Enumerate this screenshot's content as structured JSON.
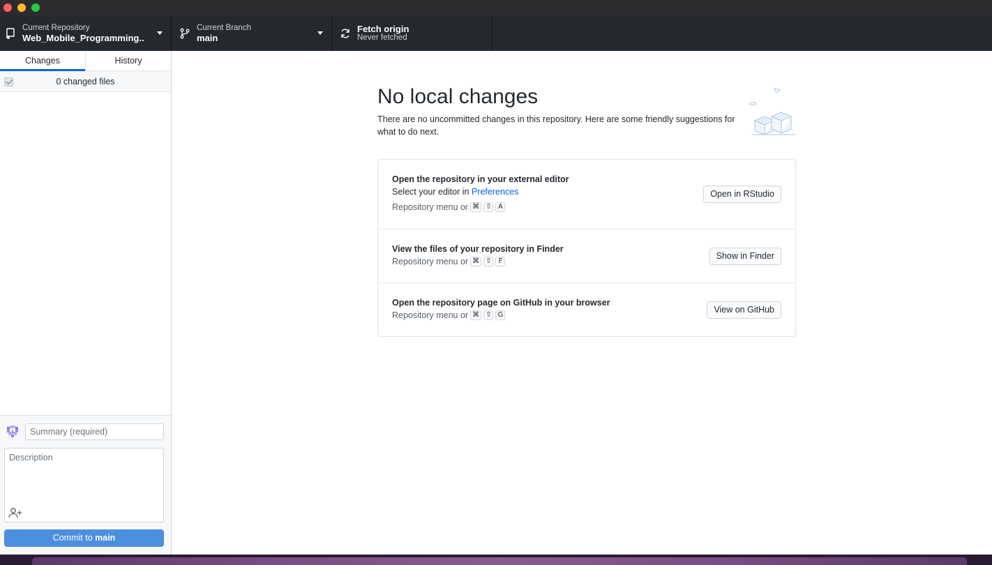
{
  "toolbar": {
    "repo": {
      "label": "Current Repository",
      "value": "Web_Mobile_Programming..."
    },
    "branch": {
      "label": "Current Branch",
      "value": "main"
    },
    "fetch": {
      "label": "Fetch origin",
      "status": "Never fetched"
    }
  },
  "sidebar": {
    "tabs": [
      {
        "label": "Changes"
      },
      {
        "label": "History"
      }
    ],
    "changed_files_label": "0 changed files",
    "commit": {
      "summary_placeholder": "Summary (required)",
      "description_placeholder": "Description",
      "button_prefix": "Commit to ",
      "button_branch": "main"
    }
  },
  "main": {
    "title": "No local changes",
    "subtitle": "There are no uncommitted changes in this repository. Here are some friendly suggestions for what to do next.",
    "suggestions": [
      {
        "title": "Open the repository in your external editor",
        "line_prefix": "Select your editor in ",
        "line_link": "Preferences",
        "menu_text": "Repository menu or",
        "keys": [
          "⌘",
          "⇧",
          "A"
        ],
        "button": "Open in RStudio"
      },
      {
        "title": "View the files of your repository in Finder",
        "menu_text": "Repository menu or",
        "keys": [
          "⌘",
          "⇧",
          "F"
        ],
        "button": "Show in Finder"
      },
      {
        "title": "Open the repository page on GitHub in your browser",
        "menu_text": "Repository menu or",
        "keys": [
          "⌘",
          "⇧",
          "G"
        ],
        "button": "View on GitHub"
      }
    ]
  },
  "colors": {
    "accent": "#0366d6",
    "commit_button": "#4c8fe0",
    "toolbar_bg": "#24292e"
  }
}
